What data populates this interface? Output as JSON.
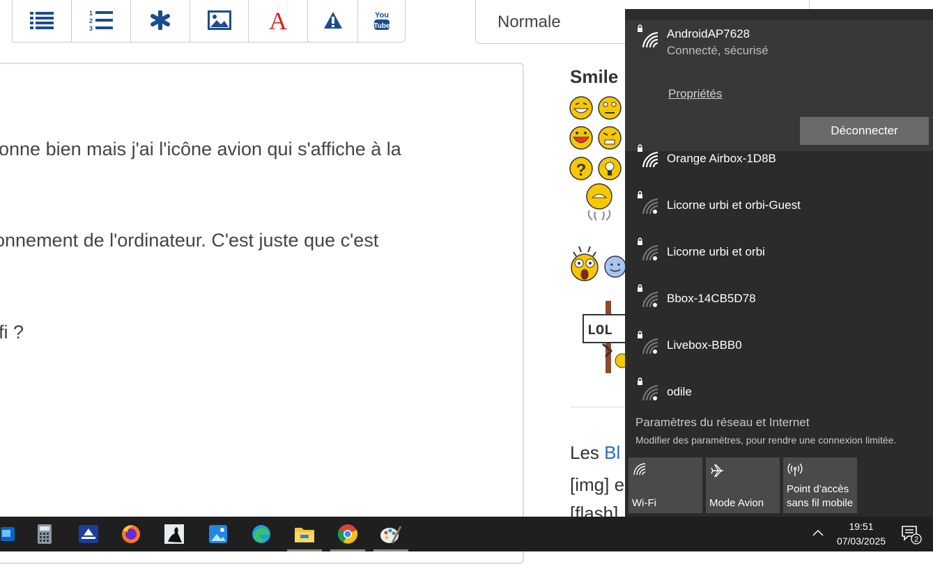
{
  "editor": {
    "font_size_value": "Normale",
    "lines": [
      "ionne bien mais j'ai l'icône avion qui s'affiche à la",
      "onnement de l'ordinateur. C'est juste que c'est",
      "ifi ?"
    ]
  },
  "sidebar": {
    "smileys_title": "Smile",
    "help_prefix": "Les ",
    "help_link": "Bl",
    "help_line2": "[img] e",
    "help_line3": "[flash]"
  },
  "network_flyout": {
    "connected": {
      "name": "AndroidAP7628",
      "status": "Connecté, sécurisé",
      "properties_link": "Propriétés",
      "disconnect_label": "Déconnecter"
    },
    "networks": [
      {
        "name": "Orange Airbox-1D8B",
        "signal": "full"
      },
      {
        "name": "Licorne urbi et orbi-Guest",
        "signal": "low"
      },
      {
        "name": "Licorne urbi et orbi",
        "signal": "low"
      },
      {
        "name": "Bbox-14CB5D78",
        "signal": "low"
      },
      {
        "name": "Livebox-BBB0",
        "signal": "low"
      },
      {
        "name": "odile",
        "signal": "low"
      }
    ],
    "settings_title": "Paramètres du réseau et Internet",
    "settings_subtitle": "Modifier des paramètres, pour rendre une connexion limitée.",
    "quick_actions": [
      {
        "label": "Wi-Fi",
        "icon": "wifi-icon"
      },
      {
        "label": "Mode Avion",
        "icon": "airplane-icon"
      },
      {
        "label": "Point d’accès sans fil mobile",
        "label_line1": "Point d’accès",
        "label_line2": "sans fil mobile",
        "icon": "hotspot-icon"
      }
    ]
  },
  "taskbar": {
    "apps": [
      "outlook-icon",
      "calculator-icon",
      "scanner-icon",
      "firefox-icon",
      "kindle-icon",
      "photos-icon",
      "edge-icon",
      "file-explorer-icon",
      "chrome-icon",
      "paint-icon"
    ],
    "time": "19:51",
    "date": "07/03/2025",
    "notification_count": "2"
  },
  "colors": {
    "flyout_bg": "#2b2b2b",
    "connected_bg": "#383838",
    "button_bg": "#6a6a6a",
    "tile_bg": "#4a4a4a",
    "taskbar_bg": "#1f1f1f",
    "toolbar_icon": "#1a4d8f",
    "font_icon_red": "#e01b1b"
  }
}
